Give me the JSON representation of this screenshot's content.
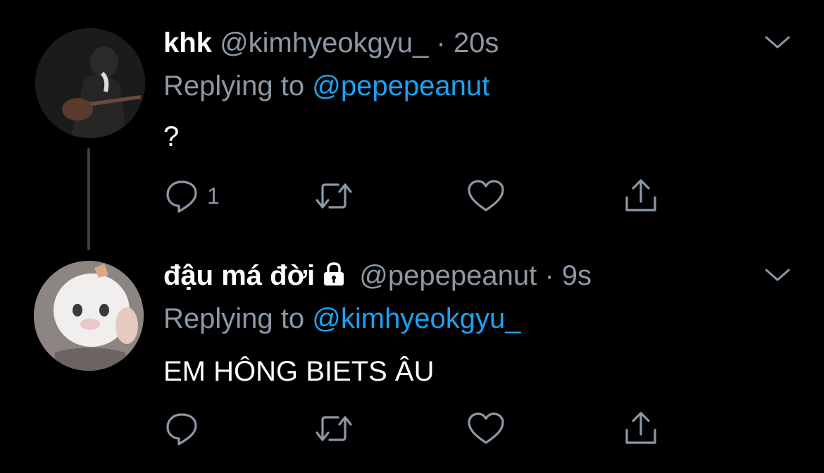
{
  "colors": {
    "background": "#000000",
    "secondary_text": "#8b98a5",
    "link": "#1da1f2",
    "thread_line": "#3d4146"
  },
  "tweets": [
    {
      "display_name": "khk",
      "handle": "@kimhyeokgyu_",
      "separator": "·",
      "time": "20s",
      "replying_prefix": "Replying to",
      "replying_handle": "@pepepeanut",
      "text": "?",
      "protected": false,
      "reply_count": "1",
      "icons": [
        "reply-icon",
        "retweet-icon",
        "like-icon",
        "share-icon",
        "caret-down-icon"
      ]
    },
    {
      "display_name": "đậu má đời",
      "handle": "@pepepeanut",
      "separator": "·",
      "time": "9s",
      "replying_prefix": "Replying to",
      "replying_handle": "@kimhyeokgyu_",
      "text": "EM HÔNG BIETS ÂU",
      "protected": true,
      "reply_count": "",
      "icons": [
        "lock-icon",
        "reply-icon",
        "retweet-icon",
        "like-icon",
        "share-icon",
        "caret-down-icon"
      ]
    }
  ]
}
